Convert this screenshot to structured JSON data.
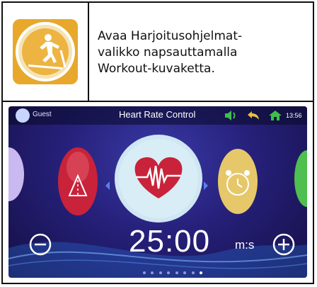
{
  "instruction": {
    "lines": [
      "Avaa Harjoitusohjelmat-",
      "valikko napsauttamalla",
      "Workout-kuvaketta."
    ]
  },
  "workout_icon": {
    "icon": "treadmill-runner-icon",
    "color": "#E0A52A"
  },
  "screen": {
    "user": "Guest",
    "title": "Heart Rate Control",
    "clock": "13:56",
    "timer_value": "25:00",
    "timer_unit": "m:s",
    "page_dots_total": 8,
    "page_dot_active": 8,
    "colors": {
      "heart_red": "#C8233A",
      "bg_blue": "#26207A",
      "alarm_yellow": "#E6C86A",
      "home_green": "#3CC048"
    }
  }
}
